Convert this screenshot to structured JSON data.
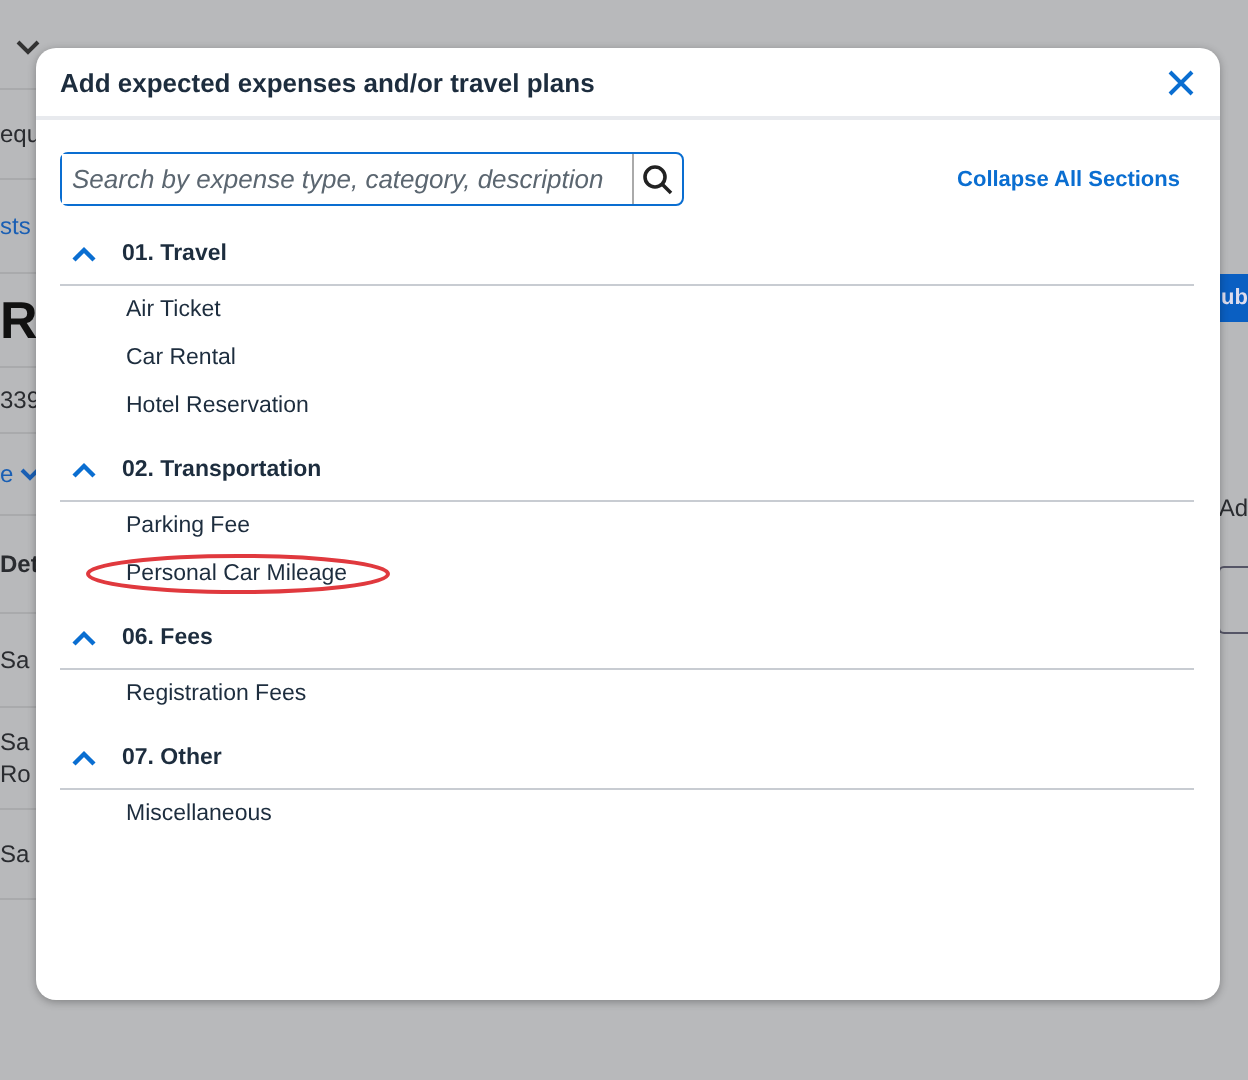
{
  "background": {
    "left_fragments": [
      {
        "kind": "chevron"
      },
      {
        "kind": "text",
        "text": "equ"
      },
      {
        "kind": "link",
        "text": "sts"
      },
      {
        "kind": "title",
        "text": "R"
      },
      {
        "kind": "text",
        "text": "339"
      },
      {
        "kind": "link_chevron",
        "text": "e"
      },
      {
        "kind": "bold",
        "text": "Det"
      },
      {
        "kind": "text",
        "text": "Sa"
      },
      {
        "kind": "text2",
        "text": "Sa",
        "text_2": "Ro"
      },
      {
        "kind": "text",
        "text": "Sa"
      }
    ],
    "right_fragments": [
      {
        "kind": "button",
        "text": "ub"
      },
      {
        "kind": "text",
        "text": "Ad"
      },
      {
        "kind": "field"
      }
    ]
  },
  "dialog": {
    "title": "Add expected expenses and/or travel plans",
    "search": {
      "placeholder": "Search by expense type, category, description"
    },
    "collapse_link": "Collapse All Sections",
    "sections": [
      {
        "title": "01. Travel",
        "expanded": true,
        "items": [
          {
            "label": "Air Ticket",
            "highlighted": false
          },
          {
            "label": "Car Rental",
            "highlighted": false
          },
          {
            "label": "Hotel Reservation",
            "highlighted": false
          }
        ]
      },
      {
        "title": "02. Transportation",
        "expanded": true,
        "items": [
          {
            "label": "Parking Fee",
            "highlighted": false
          },
          {
            "label": "Personal Car Mileage",
            "highlighted": true
          }
        ]
      },
      {
        "title": "06. Fees",
        "expanded": true,
        "items": [
          {
            "label": "Registration Fees",
            "highlighted": false
          }
        ]
      },
      {
        "title": "07. Other",
        "expanded": true,
        "items": [
          {
            "label": "Miscellaneous",
            "highlighted": false
          }
        ]
      }
    ]
  }
}
